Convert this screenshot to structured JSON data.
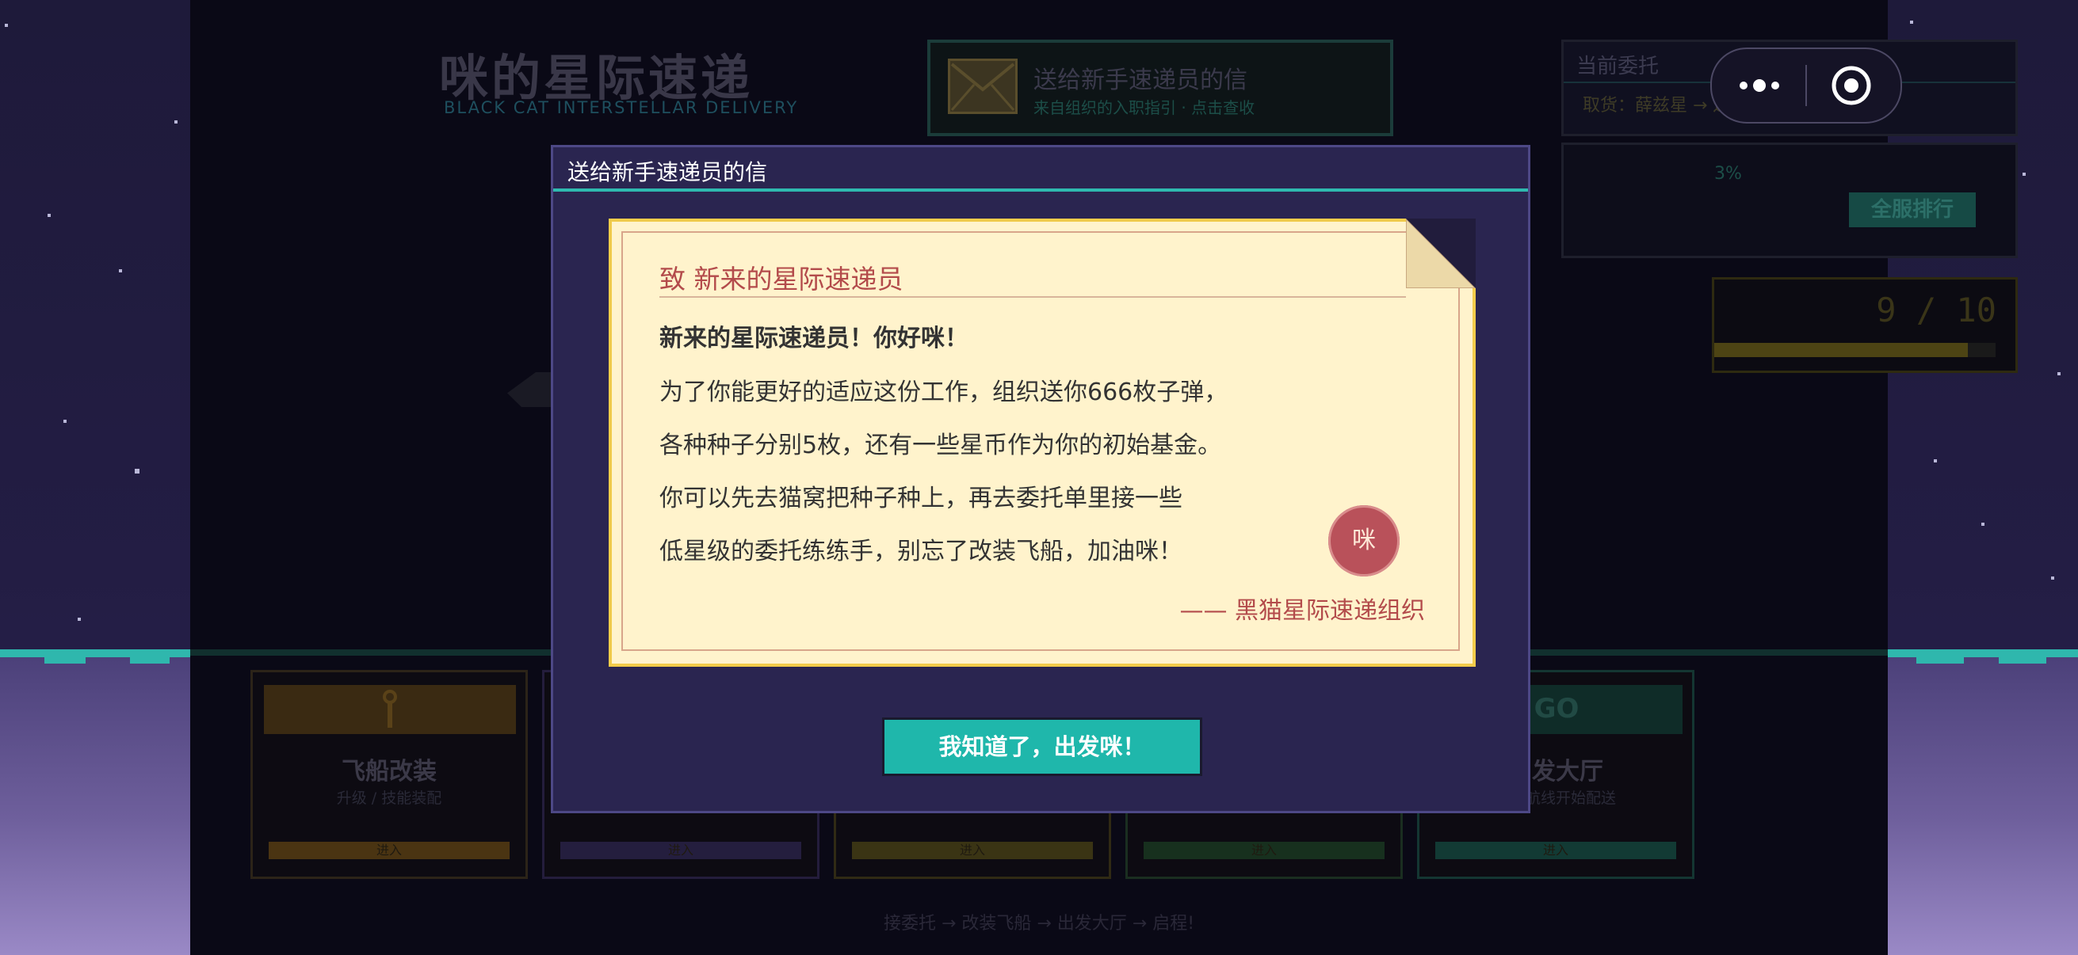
{
  "game": {
    "title": "咪的星际速递",
    "subtitle": "BLACK CAT INTERSTELLAR DELIVERY",
    "letter_card": {
      "title": "送给新手速递员的信",
      "sub": "来自组织的入职指引  ·  点击查收"
    },
    "commission": {
      "title": "当前委托",
      "route": "取货：薛兹星  →  送货：虫洞星"
    },
    "rank": {
      "percent": "3%",
      "button": "全服排行"
    },
    "stamina": {
      "value": "9 / 10",
      "fraction": 0.9
    },
    "menu": [
      {
        "name": "飞船改装",
        "desc": "升级 / 技能装配",
        "go": "进入",
        "color": "#3a2a12",
        "border": "#3a2a14"
      },
      {
        "name": "",
        "desc": "",
        "go": "进入",
        "color": "#201a36",
        "border": "#241d3c"
      },
      {
        "name": "",
        "desc": "",
        "go": "进入",
        "color": "#2c2812",
        "border": "#302a14"
      },
      {
        "name": "",
        "desc": "",
        "go": "进入",
        "color": "#162a1c",
        "border": "#1a2e20"
      },
      {
        "name": "出发大厅",
        "desc": "选择航线开始配送",
        "go": "进入",
        "header": "GO",
        "color": "#0f2c28",
        "border": "#143632"
      }
    ],
    "hint": "接委托 → 改装飞船 → 出发大厅 → 启程!"
  },
  "modal": {
    "title": "送给新手速递员的信",
    "to": "致   新来的星际速递员",
    "greeting": "新来的星际速递员！你好咪！",
    "lines": [
      "为了你能更好的适应这份工作，组织送你666枚子弹，",
      "各种种子分别5枚，还有一些星币作为你的初始基金。",
      "你可以先去猫窝把种子种上，再去委托单里接一些",
      "低星级的委托练练手，别忘了改装飞船，加油咪！"
    ],
    "seal": "咪",
    "signature": "——  黑猫星际速递组织",
    "confirm": "我知道了，出发咪！"
  },
  "colors": {
    "accent_teal": "#1fb7ab",
    "letter_bg": "#fff3cc",
    "letter_border": "#f2cc4a",
    "seal": "#b9515a",
    "ink_red": "#b34b4b"
  }
}
